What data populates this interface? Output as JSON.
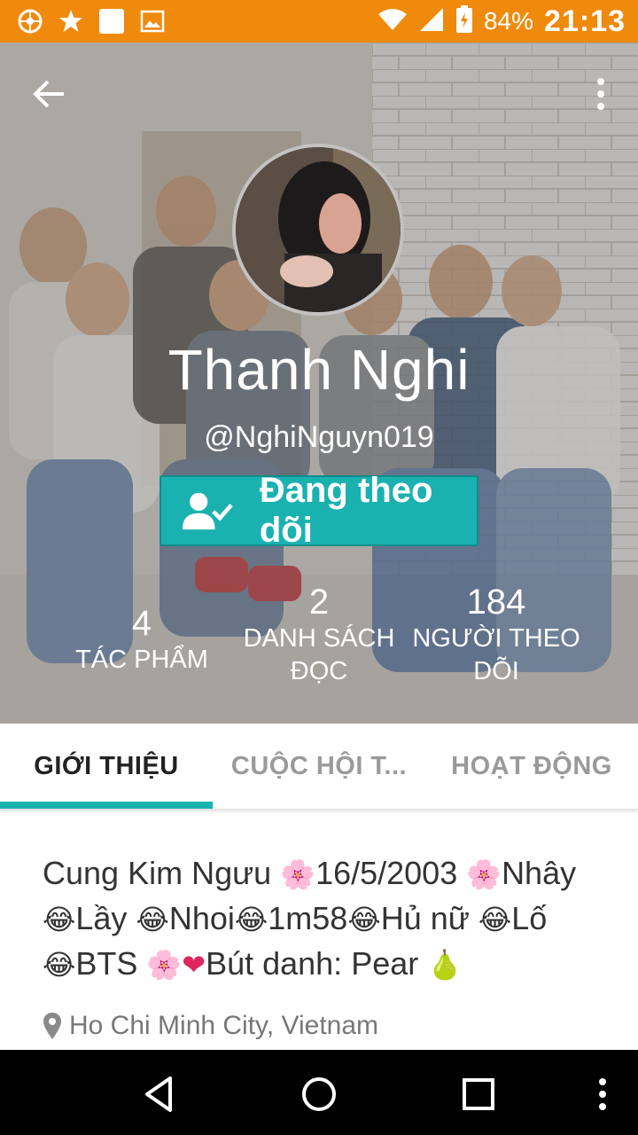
{
  "status_bar": {
    "battery_percent": "84%",
    "time": "21:13",
    "icons": [
      "app-icon",
      "star-icon",
      "square-icon",
      "image-icon",
      "wifi-icon",
      "signal-icon",
      "battery-icon"
    ]
  },
  "profile": {
    "display_name": "Thanh Nghi",
    "username": "@NghiNguyn019",
    "follow_button_label": "Đang theo dõi",
    "stats": [
      {
        "value": "4",
        "label": "TÁC PHẨM"
      },
      {
        "value": "2",
        "label": "DANH SÁCH ĐỌC"
      },
      {
        "value": "184",
        "label": "NGƯỜI THEO DÕI"
      }
    ]
  },
  "tabs": [
    {
      "label": "GIỚI THIỆU",
      "active": true
    },
    {
      "label": "CUỘC HỘI T...",
      "active": false
    },
    {
      "label": "HOẠT ĐỘNG",
      "active": false
    }
  ],
  "bio": {
    "p1": "Cung Kim Ngưu ",
    "p2": "16/5/2003 ",
    "p3": "Nhây",
    "p4": "Lầy ",
    "p5": "Nhoi",
    "p6": "1m58",
    "p7": "Hủ nữ ",
    "p8": "Lố",
    "p9": "BTS ",
    "p10": "Bút danh: Pear "
  },
  "location": "Ho Chi Minh City, Vietnam",
  "colors": {
    "status_bar": "#f08a0c",
    "accent": "#1ab2b0",
    "text": "#333333"
  }
}
